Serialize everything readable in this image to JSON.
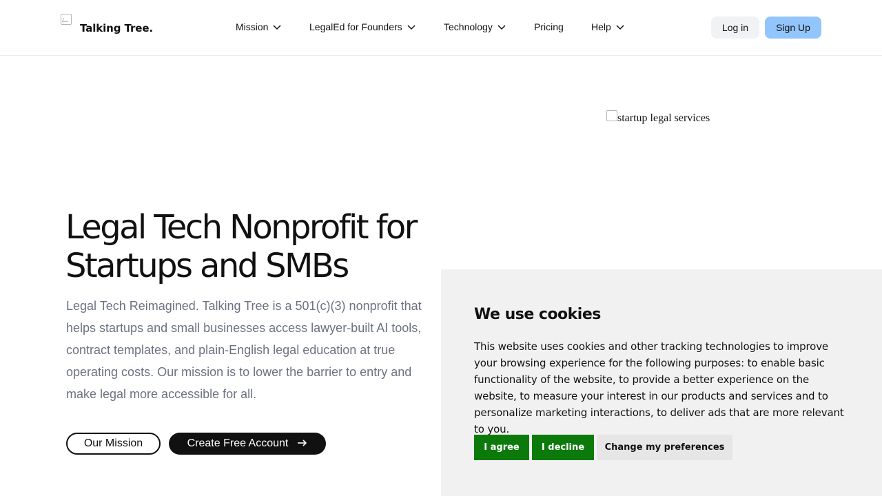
{
  "header": {
    "logo_text": "Talking Tree.",
    "nav": [
      {
        "label": "Mission",
        "has_dropdown": true
      },
      {
        "label": "LegalEd for Founders",
        "has_dropdown": true
      },
      {
        "label": "Technology",
        "has_dropdown": true
      },
      {
        "label": "Pricing",
        "has_dropdown": false
      },
      {
        "label": "Help",
        "has_dropdown": true
      }
    ],
    "login_label": "Log in",
    "signup_label": "Sign Up"
  },
  "hero": {
    "title": "Legal Tech Nonprofit for Startups and SMBs",
    "description": "Legal Tech Reimagined. Talking Tree is a 501(c)(3) nonprofit that helps startups and small businesses access lawyer-built AI tools, contract templates, and plain-English legal education at true operating costs. Our mission is to lower the barrier to entry and make legal more accessible for all.",
    "image_alt": "startup legal services",
    "mission_button": "Our Mission",
    "create_button": "Create Free Account"
  },
  "cookie_banner": {
    "title": "We use cookies",
    "text": "This website uses cookies and other tracking technologies to improve your browsing experience for the following purposes: to enable basic functionality of the website, to provide a better experience on the website, to measure your interest in our products and services and to personalize marketing interactions, to deliver ads that are more relevant to you.",
    "agree_label": "I agree",
    "decline_label": "I decline",
    "preferences_label": "Change my preferences"
  },
  "colors": {
    "signup_bg": "#93c5fd",
    "login_bg": "#f0f2f4",
    "cookie_bg": "#f1f1f1",
    "cookie_accept": "#0b7a0b",
    "description_text": "#6b7280",
    "primary_dark": "#111111"
  },
  "icons": {
    "dropdown": "chevron-down-icon",
    "create_arrow": "arrow-right-icon",
    "broken_image": "broken-image-icon"
  }
}
